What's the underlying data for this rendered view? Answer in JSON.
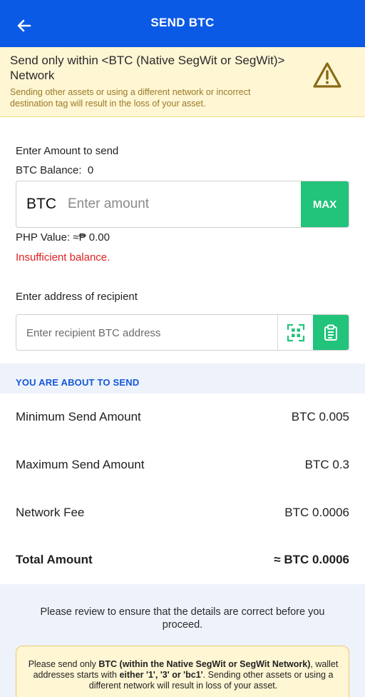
{
  "header": {
    "title": "SEND BTC"
  },
  "warning": {
    "title": "Send only within <BTC (Native SegWit or SegWit)> Network",
    "subtitle": "Sending other assets or using a different network or incorrect destination tag will result in the loss of your asset."
  },
  "amount": {
    "section_label": "Enter Amount to send",
    "balance_label": "BTC Balance:",
    "balance_value": "0",
    "currency": "BTC",
    "placeholder": "Enter amount",
    "max_label": "MAX",
    "php_value_label": "PHP Value:",
    "php_value": "≈₱ 0.00",
    "error": "Insufficient balance."
  },
  "recipient": {
    "section_label": "Enter address of recipient",
    "placeholder": "Enter recipient BTC address"
  },
  "summary": {
    "header": "YOU ARE ABOUT TO SEND",
    "rows": [
      {
        "label": "Minimum Send Amount",
        "value": "BTC 0.005"
      },
      {
        "label": "Maximum Send Amount",
        "value": "BTC 0.3"
      },
      {
        "label": "Network Fee",
        "value": "BTC 0.0006"
      },
      {
        "label": "Total Amount",
        "value": "≈ BTC 0.0006"
      }
    ]
  },
  "footer": {
    "review_text": "Please review to ensure that the details are correct before you proceed.",
    "notice": {
      "part1": "Please send only ",
      "part2": "BTC (within the Native SegWit or SegWit Network)",
      "part3": ", wallet addresses starts with ",
      "part4": "either '1', '3' or 'bc1'",
      "part5": ". Sending other assets or using a different network will result in loss of your asset."
    }
  },
  "colors": {
    "primary_blue": "#0b5ae6",
    "accent_green": "#22c37a",
    "error_red": "#e01f1f",
    "warning_bg": "#fff6d4",
    "warning_icon": "#8a6a16"
  },
  "icons": {
    "back": "arrow-left-icon",
    "warning": "warning-triangle-icon",
    "qr": "qr-scan-icon",
    "paste": "clipboard-icon"
  }
}
